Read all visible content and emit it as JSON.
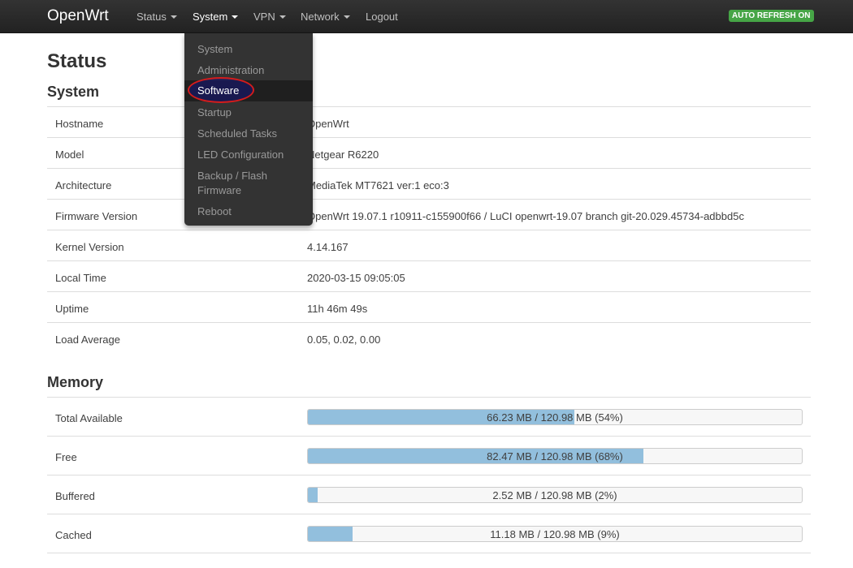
{
  "navbar": {
    "brand": "OpenWrt",
    "menu": [
      {
        "label": "Status"
      },
      {
        "label": "System"
      },
      {
        "label": "VPN"
      },
      {
        "label": "Network"
      },
      {
        "label": "Logout"
      }
    ],
    "auto_refresh": "AUTO REFRESH ON"
  },
  "dropdown": {
    "items": [
      {
        "label": "System"
      },
      {
        "label": "Administration"
      },
      {
        "label": "Software"
      },
      {
        "label": "Startup"
      },
      {
        "label": "Scheduled Tasks"
      },
      {
        "label": "LED Configuration"
      },
      {
        "label": "Backup / Flash"
      },
      {
        "label": "Firmware"
      },
      {
        "label": "Reboot"
      }
    ]
  },
  "page": {
    "title": "Status",
    "system_title": "System",
    "memory_title": "Memory"
  },
  "system_rows": [
    {
      "label": "Hostname",
      "value": "OpenWrt"
    },
    {
      "label": "Model",
      "value": "Netgear R6220"
    },
    {
      "label": "Architecture",
      "value": "MediaTek MT7621 ver:1 eco:3"
    },
    {
      "label": "Firmware Version",
      "value": "OpenWrt 19.07.1 r10911-c155900f66 / LuCI openwrt-19.07 branch git-20.029.45734-adbbd5c"
    },
    {
      "label": "Kernel Version",
      "value": "4.14.167"
    },
    {
      "label": "Local Time",
      "value": "2020-03-15 09:05:05"
    },
    {
      "label": "Uptime",
      "value": "11h 46m 49s"
    },
    {
      "label": "Load Average",
      "value": "0.05, 0.02, 0.00"
    }
  ],
  "memory_rows": [
    {
      "label": "Total Available",
      "text": "66.23 MB / 120.98 MB (54%)",
      "fraction": 0.54
    },
    {
      "label": "Free",
      "text": "82.47 MB / 120.98 MB (68%)",
      "fraction": 0.68
    },
    {
      "label": "Buffered",
      "text": "2.52 MB / 120.98 MB (2%)",
      "fraction": 0.02
    },
    {
      "label": "Cached",
      "text": "11.18 MB / 120.98 MB (9%)",
      "fraction": 0.09
    }
  ],
  "colors": {
    "navbar_bg": "#222222",
    "badge_green": "#46a546",
    "bar_fill": "#92bfdd",
    "highlight_ring": "#d41c1c"
  }
}
